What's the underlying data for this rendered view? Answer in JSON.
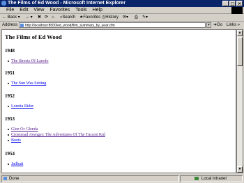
{
  "window": {
    "title": "The Films of Ed Wood - Microsoft Internet Explorer"
  },
  "menu": [
    "File",
    "Edit",
    "View",
    "Favorites",
    "Tools",
    "Help"
  ],
  "toolbar": {
    "back": "Back",
    "search": "Search",
    "favorites": "Favorites",
    "history": "History"
  },
  "address": {
    "label": "Address",
    "url": "http://localhost:8500/ed_wood/film_summary_by_year.cfm",
    "go": "Go",
    "links": "Links"
  },
  "page": {
    "title": "The Films of Ed Wood",
    "years": [
      {
        "year": "1948",
        "films": [
          "The Streets Of Laredo"
        ]
      },
      {
        "year": "1951",
        "films": [
          "The Sun Was Setting"
        ]
      },
      {
        "year": "1952",
        "films": [
          "Loretta Rider"
        ]
      },
      {
        "year": "1953",
        "films": [
          "Glen Or Glenda",
          "Crossroad Avenger: The Adventures Of The Tucson Kid",
          "Boots"
        ]
      },
      {
        "year": "1954",
        "films": [
          "Jailbait"
        ]
      }
    ]
  },
  "status": {
    "text": "Done",
    "zone": "Local intranet"
  }
}
